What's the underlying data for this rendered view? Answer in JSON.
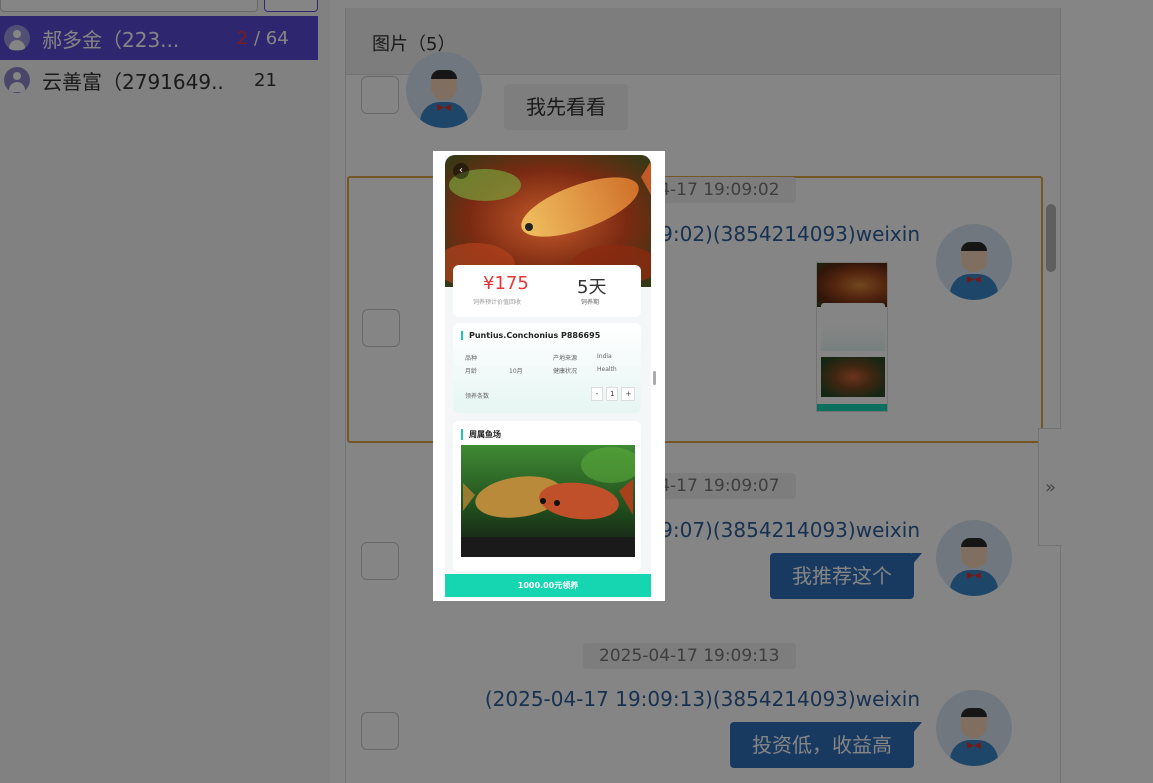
{
  "contacts": [
    {
      "name": "郝多金（223...",
      "unread": "2",
      "total": "/ 64",
      "active": true
    },
    {
      "name": "云善富（2791649...",
      "unread": "",
      "total": "21",
      "active": false
    }
  ],
  "chat": {
    "header_title": "图片（5）",
    "messages": [
      {
        "bubble": "我先看看"
      },
      {
        "time": "2025-04-17 19:09:02",
        "sender": "(2025-04-17 19:09:02)(3854214093)weixin"
      },
      {
        "time": "2025-04-17 19:09:07",
        "sender": "(2025-04-17 19:09:07)(3854214093)weixin",
        "bubble": "我推荐这个"
      },
      {
        "time": "2025-04-17 19:09:13",
        "sender": "(2025-04-17 19:09:13)(3854214093)weixin",
        "bubble": "投资低，收益高"
      }
    ],
    "side_tab_glyph": "»"
  },
  "preview": {
    "back_glyph": "‹",
    "price": "¥175",
    "price_sub": "饲养预计价值回收",
    "days": "5天",
    "days_sub": "饲养期",
    "fish_title": "Puntius.Conchonius P886695",
    "fields": {
      "breed_label": "品种",
      "origin_label": "产地来源",
      "origin_value": "India",
      "age_label": "月龄",
      "age_value": "10月",
      "health_label": "健康状况",
      "health_value": "Health",
      "count_label": "领养条数"
    },
    "stepper": {
      "minus": "-",
      "value": "1",
      "plus": "+"
    },
    "photo_title": "周属鱼场",
    "button": "1000.00元领养"
  }
}
